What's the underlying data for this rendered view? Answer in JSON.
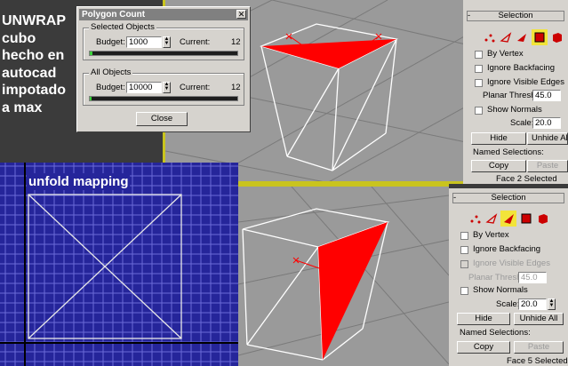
{
  "caption": {
    "text": "UNWRAP\ncubo\nhecho en\nautocad\nimpotado\na max"
  },
  "dialog": {
    "title": "Polygon Count",
    "close": "✕",
    "selected_group": "Selected Objects",
    "all_group": "All Objects",
    "budget_label": "Budget:",
    "current_label": "Current:",
    "selected_budget": "1000",
    "selected_current": "12",
    "all_budget": "10000",
    "all_current": "12",
    "selected_fill": 0.02,
    "all_fill": 0.01,
    "close_button": "Close"
  },
  "uv_editor": {
    "label": "unfold mapping"
  },
  "panel_top": {
    "title": "Selection",
    "minus": "-",
    "by_vertex": "By Vertex",
    "ignore_backfacing": "Ignore Backfacing",
    "ignore_visible_edges": "Ignore Visible Edges",
    "planar_thresh": "Planar Thresh:",
    "planar_value": "45.0",
    "show_normals": "Show Normals",
    "scale": "Scale:",
    "scale_value": "20.0",
    "hide": "Hide",
    "unhide_all": "Unhide All",
    "named_selections": "Named Selections:",
    "copy": "Copy",
    "paste": "Paste",
    "status": "Face 2 Selected"
  },
  "panel_bottom": {
    "title": "Selection",
    "minus": "-",
    "by_vertex": "By Vertex",
    "ignore_backfacing": "Ignore Backfacing",
    "ignore_visible_edges": "Ignore Visible Edges",
    "planar_thresh": "Planar Thresh:",
    "planar_value": "45.0",
    "show_normals": "Show Normals",
    "scale": "Scale:",
    "scale_value": "20.0",
    "hide": "Hide",
    "unhide_all": "Unhide All",
    "named_selections": "Named Selections:",
    "copy": "Copy",
    "paste": "Paste",
    "status": "Face 5 Selected"
  },
  "colors": {
    "selected_face": "#ff0000",
    "viewport_border": "#c9c41e",
    "uv_bg": "#25259a",
    "progress": "#3bd13b"
  }
}
